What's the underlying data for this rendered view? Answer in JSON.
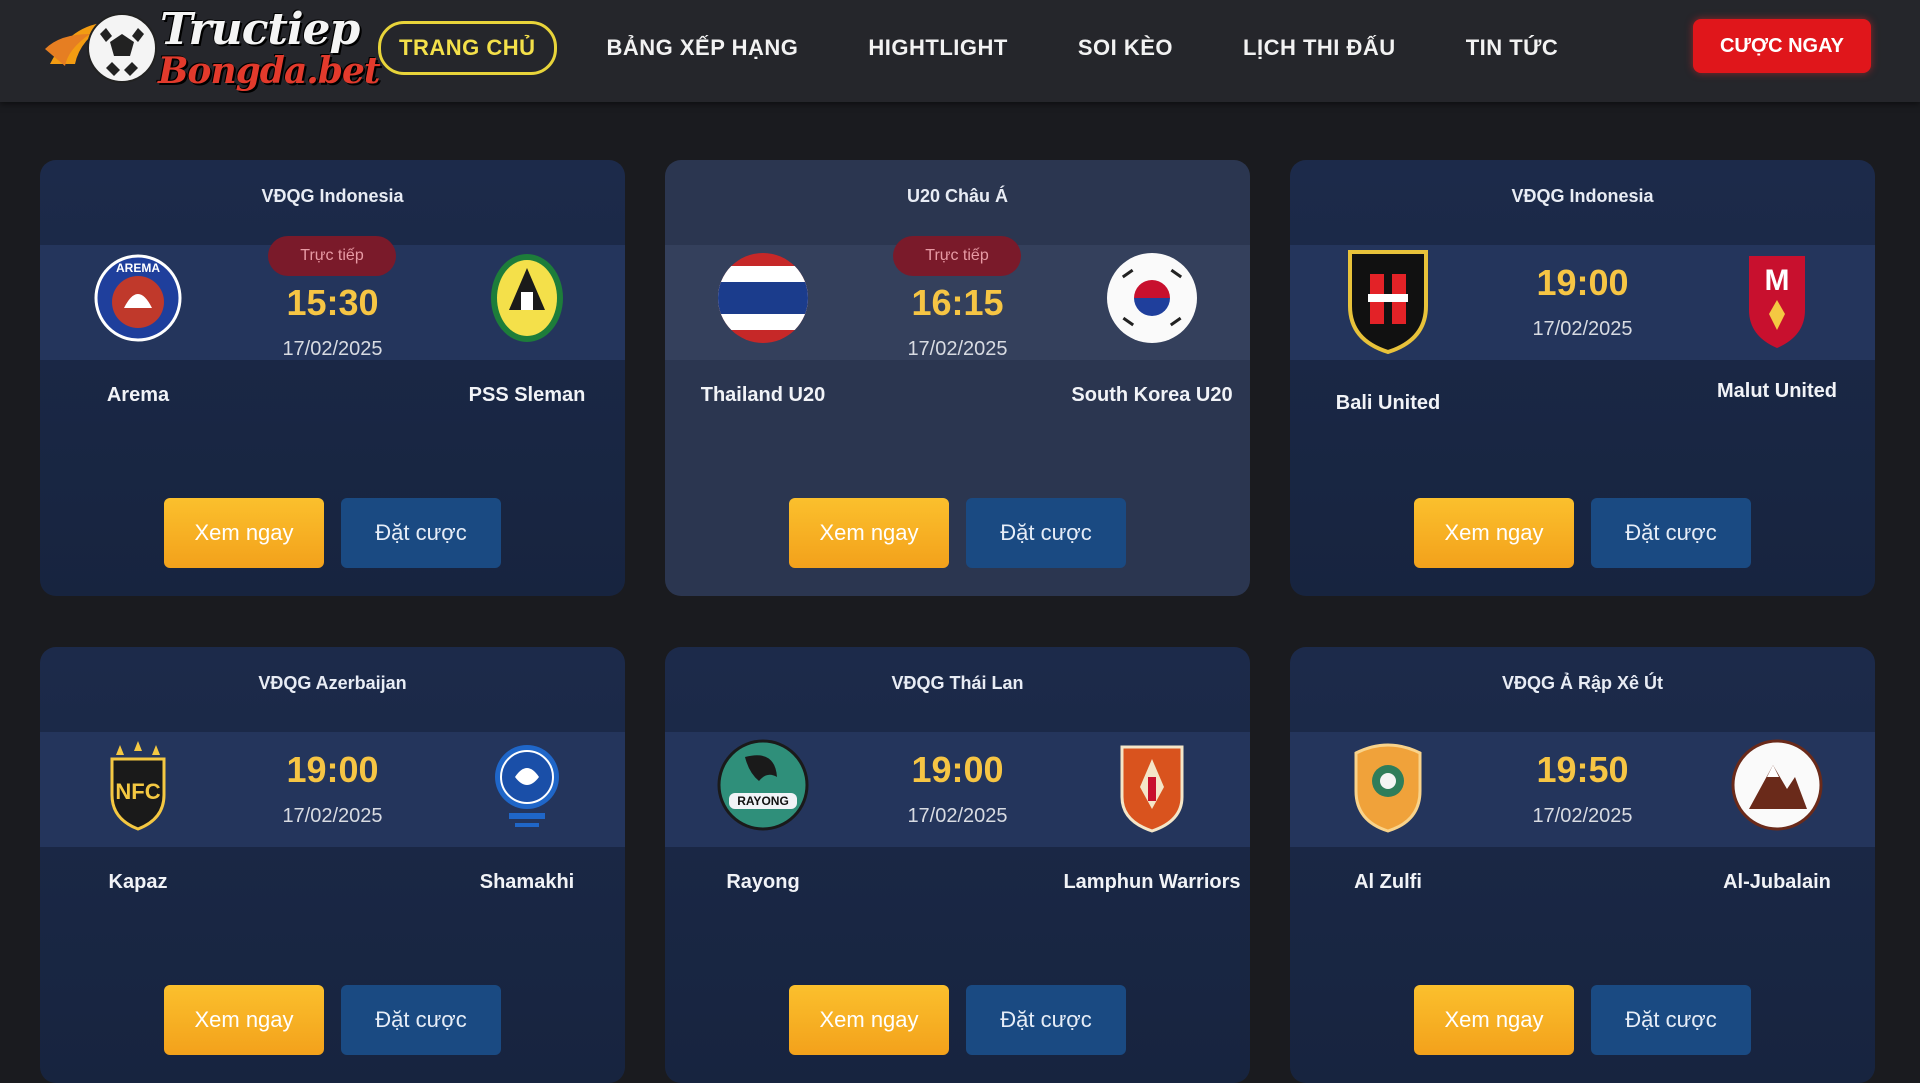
{
  "header": {
    "logo_line1": "Tructiep",
    "logo_line2": "Bongda.bet",
    "nav": [
      {
        "label": "TRANG CHỦ",
        "active": true
      },
      {
        "label": "BẢNG XẾP HẠNG",
        "active": false
      },
      {
        "label": "HIGHTLIGHT",
        "active": false
      },
      {
        "label": "SOI KÈO",
        "active": false
      },
      {
        "label": "LỊCH THI ĐẤU",
        "active": false
      },
      {
        "label": "TIN TỨC",
        "active": false
      }
    ],
    "cta_label": "CƯỢC NGAY"
  },
  "buttons": {
    "watch": "Xem ngay",
    "bet": "Đặt cược"
  },
  "live_label": "Trực tiếp",
  "matches": [
    {
      "league": "VĐQG Indonesia",
      "live": true,
      "time": "15:30",
      "date": "17/02/2025",
      "home": "Arema",
      "away": "PSS Sleman",
      "home_logo": "arema-crest",
      "away_logo": "pss-sleman-crest"
    },
    {
      "league": "U20 Châu Á",
      "live": true,
      "time": "16:15",
      "date": "17/02/2025",
      "home": "Thailand U20",
      "away": "South Korea U20",
      "home_logo": "thailand-flag",
      "away_logo": "south-korea-flag"
    },
    {
      "league": "VĐQG Indonesia",
      "live": false,
      "time": "19:00",
      "date": "17/02/2025",
      "home": "Bali United",
      "away": "Malut United",
      "home_logo": "bali-united-crest",
      "away_logo": "malut-united-crest"
    },
    {
      "league": "VĐQG Azerbaijan",
      "live": false,
      "time": "19:00",
      "date": "17/02/2025",
      "home": "Kapaz",
      "away": "Shamakhi",
      "home_logo": "kapaz-crest",
      "away_logo": "shamakhi-crest"
    },
    {
      "league": "VĐQG Thái Lan",
      "live": false,
      "time": "19:00",
      "date": "17/02/2025",
      "home": "Rayong",
      "away": "Lamphun Warriors",
      "home_logo": "rayong-crest",
      "away_logo": "lamphun-crest"
    },
    {
      "league": "VĐQG Ả Rập Xê Út",
      "live": false,
      "time": "19:50",
      "date": "17/02/2025",
      "home": "Al Zulfi",
      "away": "Al-Jubalain",
      "home_logo": "al-zulfi-crest",
      "away_logo": "al-jubalain-crest"
    }
  ],
  "colors": {
    "accent": "#f6c544",
    "cta": "#e0161b",
    "card": "#1c2a4a",
    "bet_button": "#1a4a82"
  }
}
